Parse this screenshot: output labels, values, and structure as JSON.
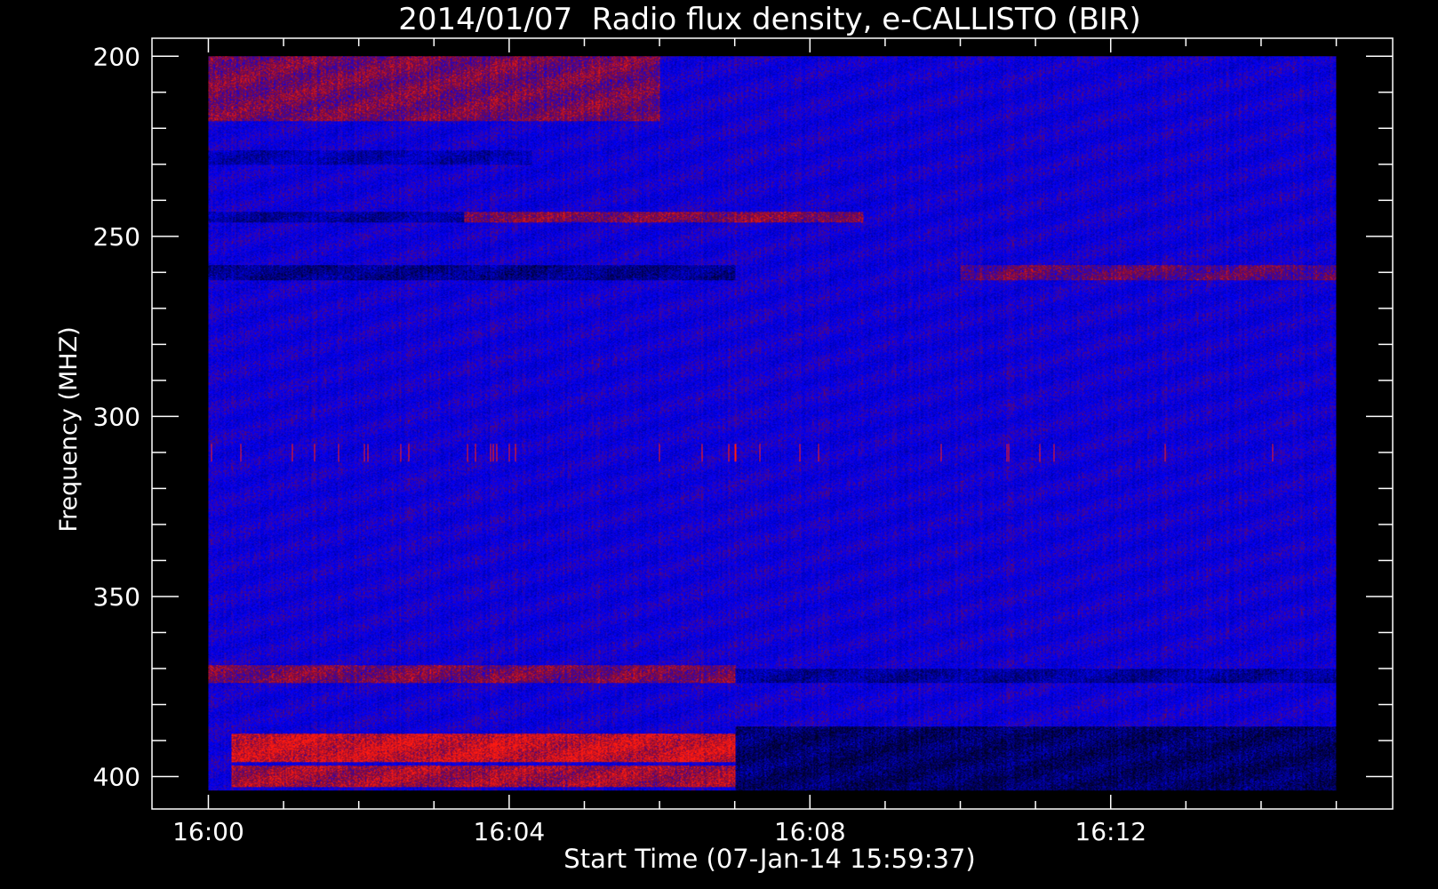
{
  "chart_data": {
    "type": "heatmap",
    "title": "2014/01/07  Radio flux density, e-CALLISTO (BIR)",
    "xlabel": "Start Time (07-Jan-14 15:59:37)",
    "ylabel": "Frequency (MHZ)",
    "x_ticks": [
      "16:00",
      "16:04",
      "16:08",
      "16:12"
    ],
    "x_tick_minutes": [
      0,
      4,
      8,
      12
    ],
    "x_minor_step_minutes": 1,
    "xlim_minutes": [
      -0.75,
      15.75
    ],
    "data_x_range_minutes": [
      0,
      15
    ],
    "y_ticks": [
      200,
      250,
      300,
      350,
      400
    ],
    "y_minor_step": 10,
    "ylim": [
      195,
      409
    ],
    "data_y_range": [
      200,
      404
    ],
    "y_inverted": true,
    "colors": {
      "background": "#000000",
      "frame": "#ffffff",
      "low": "#0000ff",
      "dark": "#000020",
      "mid": "#7a0a3a",
      "high": "#ff1a10"
    },
    "features": [
      {
        "kind": "band",
        "name": "bright",
        "f_range": [
          388,
          396
        ],
        "t_range": [
          0.3,
          7.0
        ],
        "level": 0.95
      },
      {
        "kind": "band",
        "name": "bright",
        "f_range": [
          397,
          403
        ],
        "t_range": [
          0.3,
          7.0
        ],
        "level": 0.75
      },
      {
        "kind": "band",
        "name": "dark",
        "f_range": [
          386,
          404
        ],
        "t_range": [
          7.0,
          15.0
        ],
        "level": -0.8
      },
      {
        "kind": "band",
        "name": "warm",
        "f_range": [
          200,
          218
        ],
        "t_range": [
          0.0,
          6.0
        ],
        "level": 0.55
      },
      {
        "kind": "band",
        "name": "warm",
        "f_range": [
          243,
          246
        ],
        "t_range": [
          3.4,
          8.7
        ],
        "level": 0.6
      },
      {
        "kind": "band",
        "name": "dark",
        "f_range": [
          258,
          262
        ],
        "t_range": [
          0.0,
          7.0
        ],
        "level": -0.6
      },
      {
        "kind": "band",
        "name": "dark",
        "f_range": [
          243,
          246
        ],
        "t_range": [
          0.0,
          3.4
        ],
        "level": -0.5
      },
      {
        "kind": "band",
        "name": "warm",
        "f_range": [
          369,
          374
        ],
        "t_range": [
          0.0,
          7.0
        ],
        "level": 0.55
      },
      {
        "kind": "band",
        "name": "dark",
        "f_range": [
          370,
          374
        ],
        "t_range": [
          7.0,
          15.0
        ],
        "level": -0.5
      },
      {
        "kind": "band",
        "name": "warm",
        "f_range": [
          258,
          262
        ],
        "t_range": [
          10.0,
          15.0
        ],
        "level": 0.45
      },
      {
        "kind": "band",
        "name": "dark",
        "f_range": [
          226,
          230
        ],
        "t_range": [
          0.0,
          4.3
        ],
        "level": -0.4
      },
      {
        "kind": "dots",
        "name": "spikes",
        "f": 310,
        "t_range": [
          0.0,
          15.0
        ],
        "level": 0.9
      }
    ]
  }
}
